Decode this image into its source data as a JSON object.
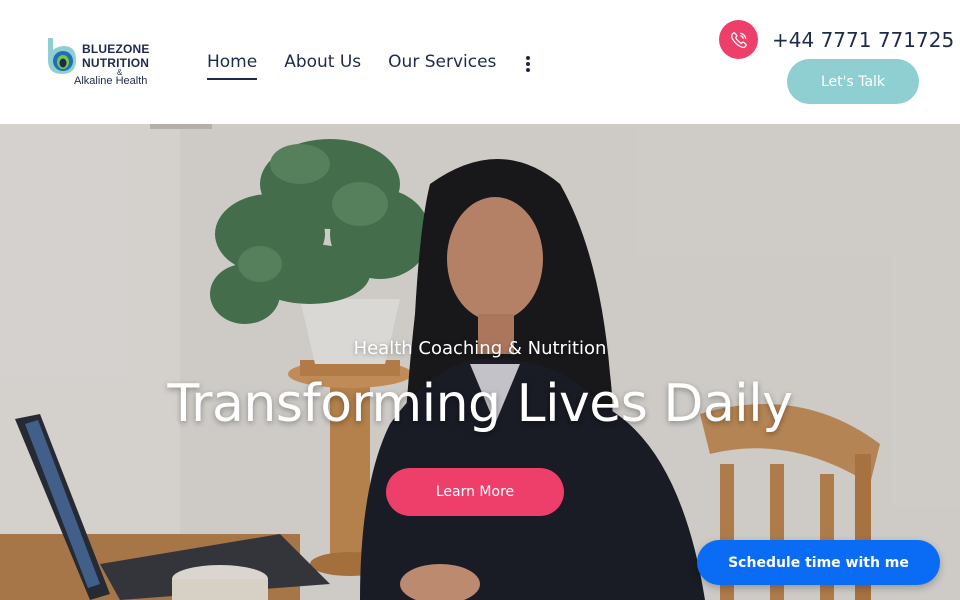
{
  "brand": {
    "line1": "BLUEZONE",
    "line2": "NUTRITION",
    "amp": "&",
    "line3": "Alkaline  Health",
    "colors": {
      "navy": "#1d2a4d",
      "teal": "#8fcfd2",
      "pink": "#ee3f6b",
      "blue": "#0a6cf5"
    }
  },
  "nav": {
    "items": [
      {
        "label": "Home",
        "active": true
      },
      {
        "label": "About Us",
        "active": false
      },
      {
        "label": "Our Services",
        "active": false
      }
    ],
    "more_icon": "vertical-ellipsis-icon"
  },
  "contact": {
    "phone_icon": "phone-icon",
    "phone": "+44 7771 771725",
    "cta": "Let's Talk"
  },
  "hero": {
    "subtitle": "Health Coaching & Nutrition",
    "title": "Transforming Lives Daily",
    "button": "Learn More"
  },
  "widget": {
    "schedule": "Schedule time with me"
  }
}
